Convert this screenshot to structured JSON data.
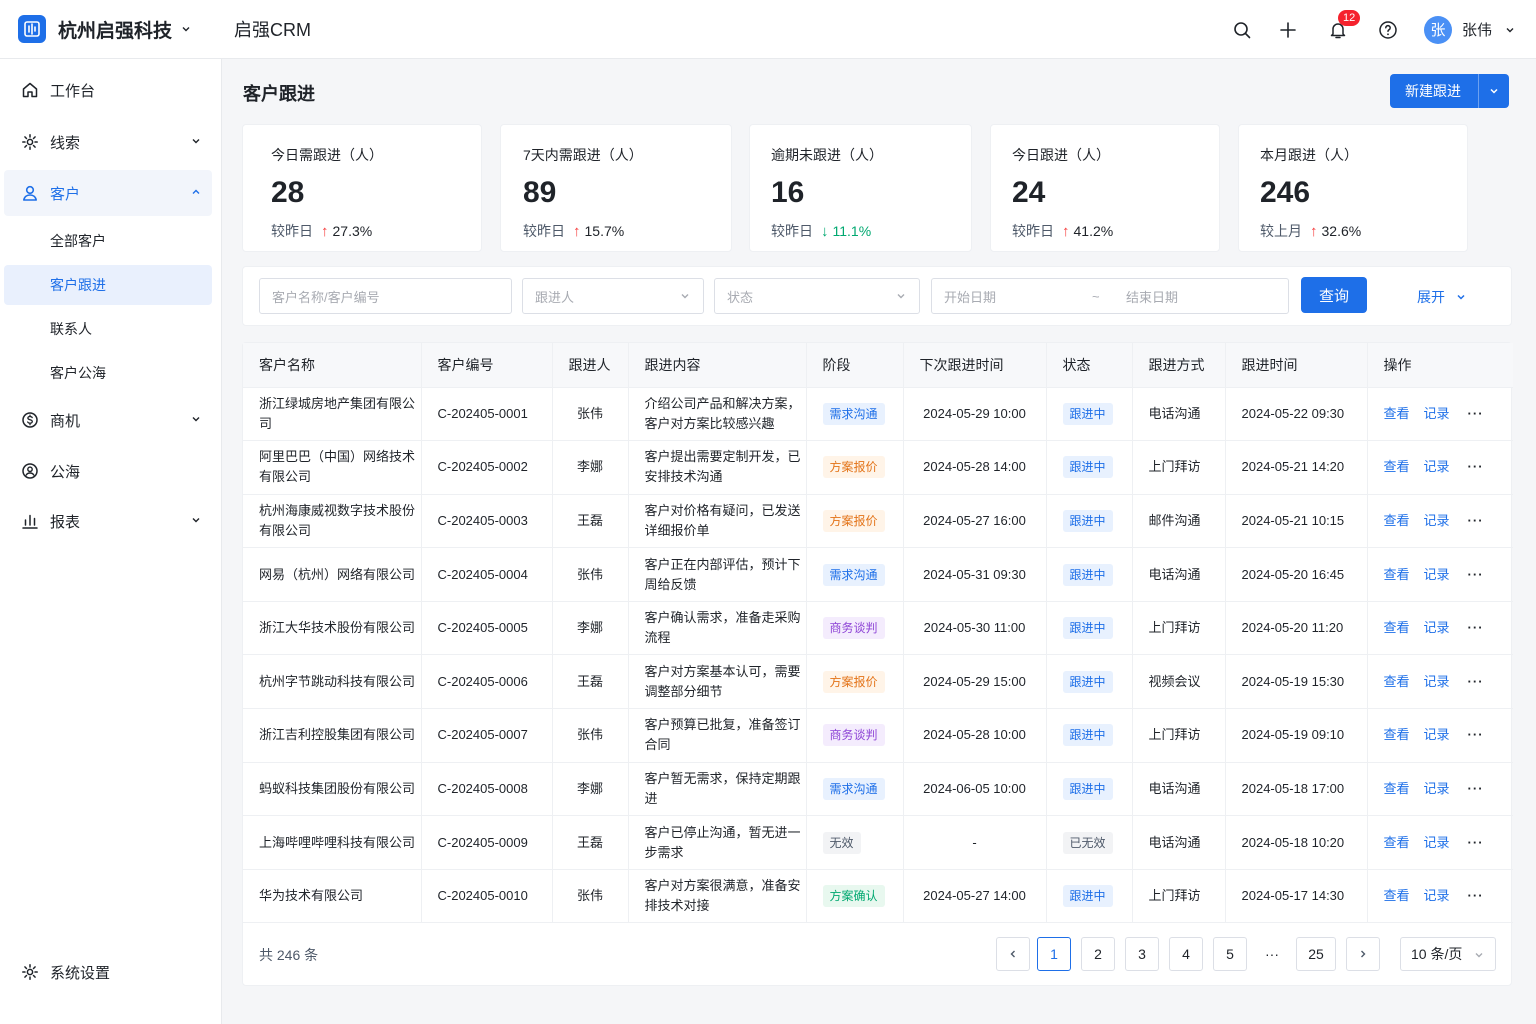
{
  "header": {
    "company": "杭州启强科技",
    "app_name": "启强CRM",
    "notification_count": "12",
    "avatar_char": "张",
    "user_name": "张伟"
  },
  "sidebar": {
    "items": [
      {
        "label": "工作台"
      },
      {
        "label": "线索"
      },
      {
        "label": "客户"
      },
      {
        "label": "全部客户"
      },
      {
        "label": "客户跟进"
      },
      {
        "label": "联系人"
      },
      {
        "label": "客户公海"
      },
      {
        "label": "商机"
      },
      {
        "label": "公海"
      },
      {
        "label": "报表"
      },
      {
        "label": "系统设置"
      }
    ]
  },
  "page": {
    "title": "客户跟进",
    "new_button": "新建跟进"
  },
  "stats": [
    {
      "title": "今日需跟进（人）",
      "value": "28",
      "compare": "较昨日",
      "change": "27.3%",
      "dir": "up"
    },
    {
      "title": "7天内需跟进（人）",
      "value": "89",
      "compare": "较昨日",
      "change": "15.7%",
      "dir": "up"
    },
    {
      "title": "逾期未跟进（人）",
      "value": "16",
      "compare": "较昨日",
      "change": "11.1%",
      "dir": "down"
    },
    {
      "title": "今日跟进（人）",
      "value": "24",
      "compare": "较昨日",
      "change": "41.2%",
      "dir": "up"
    },
    {
      "title": "本月跟进（人）",
      "value": "246",
      "compare": "较上月",
      "change": "32.6%",
      "dir": "up"
    }
  ],
  "filter": {
    "name_placeholder": "客户名称/客户编号",
    "owner_placeholder": "跟进人",
    "status_placeholder": "状态",
    "start_placeholder": "开始日期",
    "range_sep": "~",
    "end_placeholder": "结束日期",
    "query": "查询",
    "expand": "展开"
  },
  "table": {
    "columns": [
      "客户名称",
      "客户编号",
      "跟进人",
      "跟进内容",
      "阶段",
      "下次跟进时间",
      "状态",
      "跟进方式",
      "跟进时间",
      "操作"
    ],
    "action_view": "查看",
    "action_record": "记录",
    "action_more": "···",
    "rows": [
      [
        "浙江绿城房地产集团有限公司",
        "C-202405-0001",
        "张伟",
        "介绍公司产品和解决方案，客户对方案比较感兴趣",
        "需求沟通",
        "2024-05-29 10:00",
        "跟进中",
        "电话沟通",
        "2024-05-22 09:30"
      ],
      [
        "阿里巴巴（中国）网络技术有限公司",
        "C-202405-0002",
        "李娜",
        "客户提出需要定制开发，已安排技术沟通",
        "方案报价",
        "2024-05-28 14:00",
        "跟进中",
        "上门拜访",
        "2024-05-21 14:20"
      ],
      [
        "杭州海康威视数字技术股份有限公司",
        "C-202405-0003",
        "王磊",
        "客户对价格有疑问，已发送详细报价单",
        "方案报价",
        "2024-05-27 16:00",
        "跟进中",
        "邮件沟通",
        "2024-05-21 10:15"
      ],
      [
        "网易（杭州）网络有限公司",
        "C-202405-0004",
        "张伟",
        "客户正在内部评估，预计下周给反馈",
        "需求沟通",
        "2024-05-31 09:30",
        "跟进中",
        "电话沟通",
        "2024-05-20 16:45"
      ],
      [
        "浙江大华技术股份有限公司",
        "C-202405-0005",
        "李娜",
        "客户确认需求，准备走采购流程",
        "商务谈判",
        "2024-05-30 11:00",
        "跟进中",
        "上门拜访",
        "2024-05-20 11:20"
      ],
      [
        "杭州字节跳动科技有限公司",
        "C-202405-0006",
        "王磊",
        "客户对方案基本认可，需要调整部分细节",
        "方案报价",
        "2024-05-29 15:00",
        "跟进中",
        "视频会议",
        "2024-05-19 15:30"
      ],
      [
        "浙江吉利控股集团有限公司",
        "C-202405-0007",
        "张伟",
        "客户预算已批复，准备签订合同",
        "商务谈判",
        "2024-05-28 10:00",
        "跟进中",
        "上门拜访",
        "2024-05-19 09:10"
      ],
      [
        "蚂蚁科技集团股份有限公司",
        "C-202405-0008",
        "李娜",
        "客户暂无需求，保持定期跟进",
        "需求沟通",
        "2024-06-05 10:00",
        "跟进中",
        "电话沟通",
        "2024-05-18 17:00"
      ],
      [
        "上海哔哩哔哩科技有限公司",
        "C-202405-0009",
        "王磊",
        "客户已停止沟通，暂无进一步需求",
        "无效",
        "-",
        "已无效",
        "电话沟通",
        "2024-05-18 10:20"
      ],
      [
        "华为技术有限公司",
        "C-202405-0010",
        "张伟",
        "客户对方案很满意，准备安排技术对接",
        "方案确认",
        "2024-05-27 14:00",
        "跟进中",
        "上门拜访",
        "2024-05-17 14:30"
      ]
    ]
  },
  "pagination": {
    "total": "共 246 条",
    "pages": [
      "1",
      "2",
      "3",
      "4",
      "5",
      "···",
      "25"
    ],
    "current": "1",
    "page_size": "10 条/页"
  }
}
